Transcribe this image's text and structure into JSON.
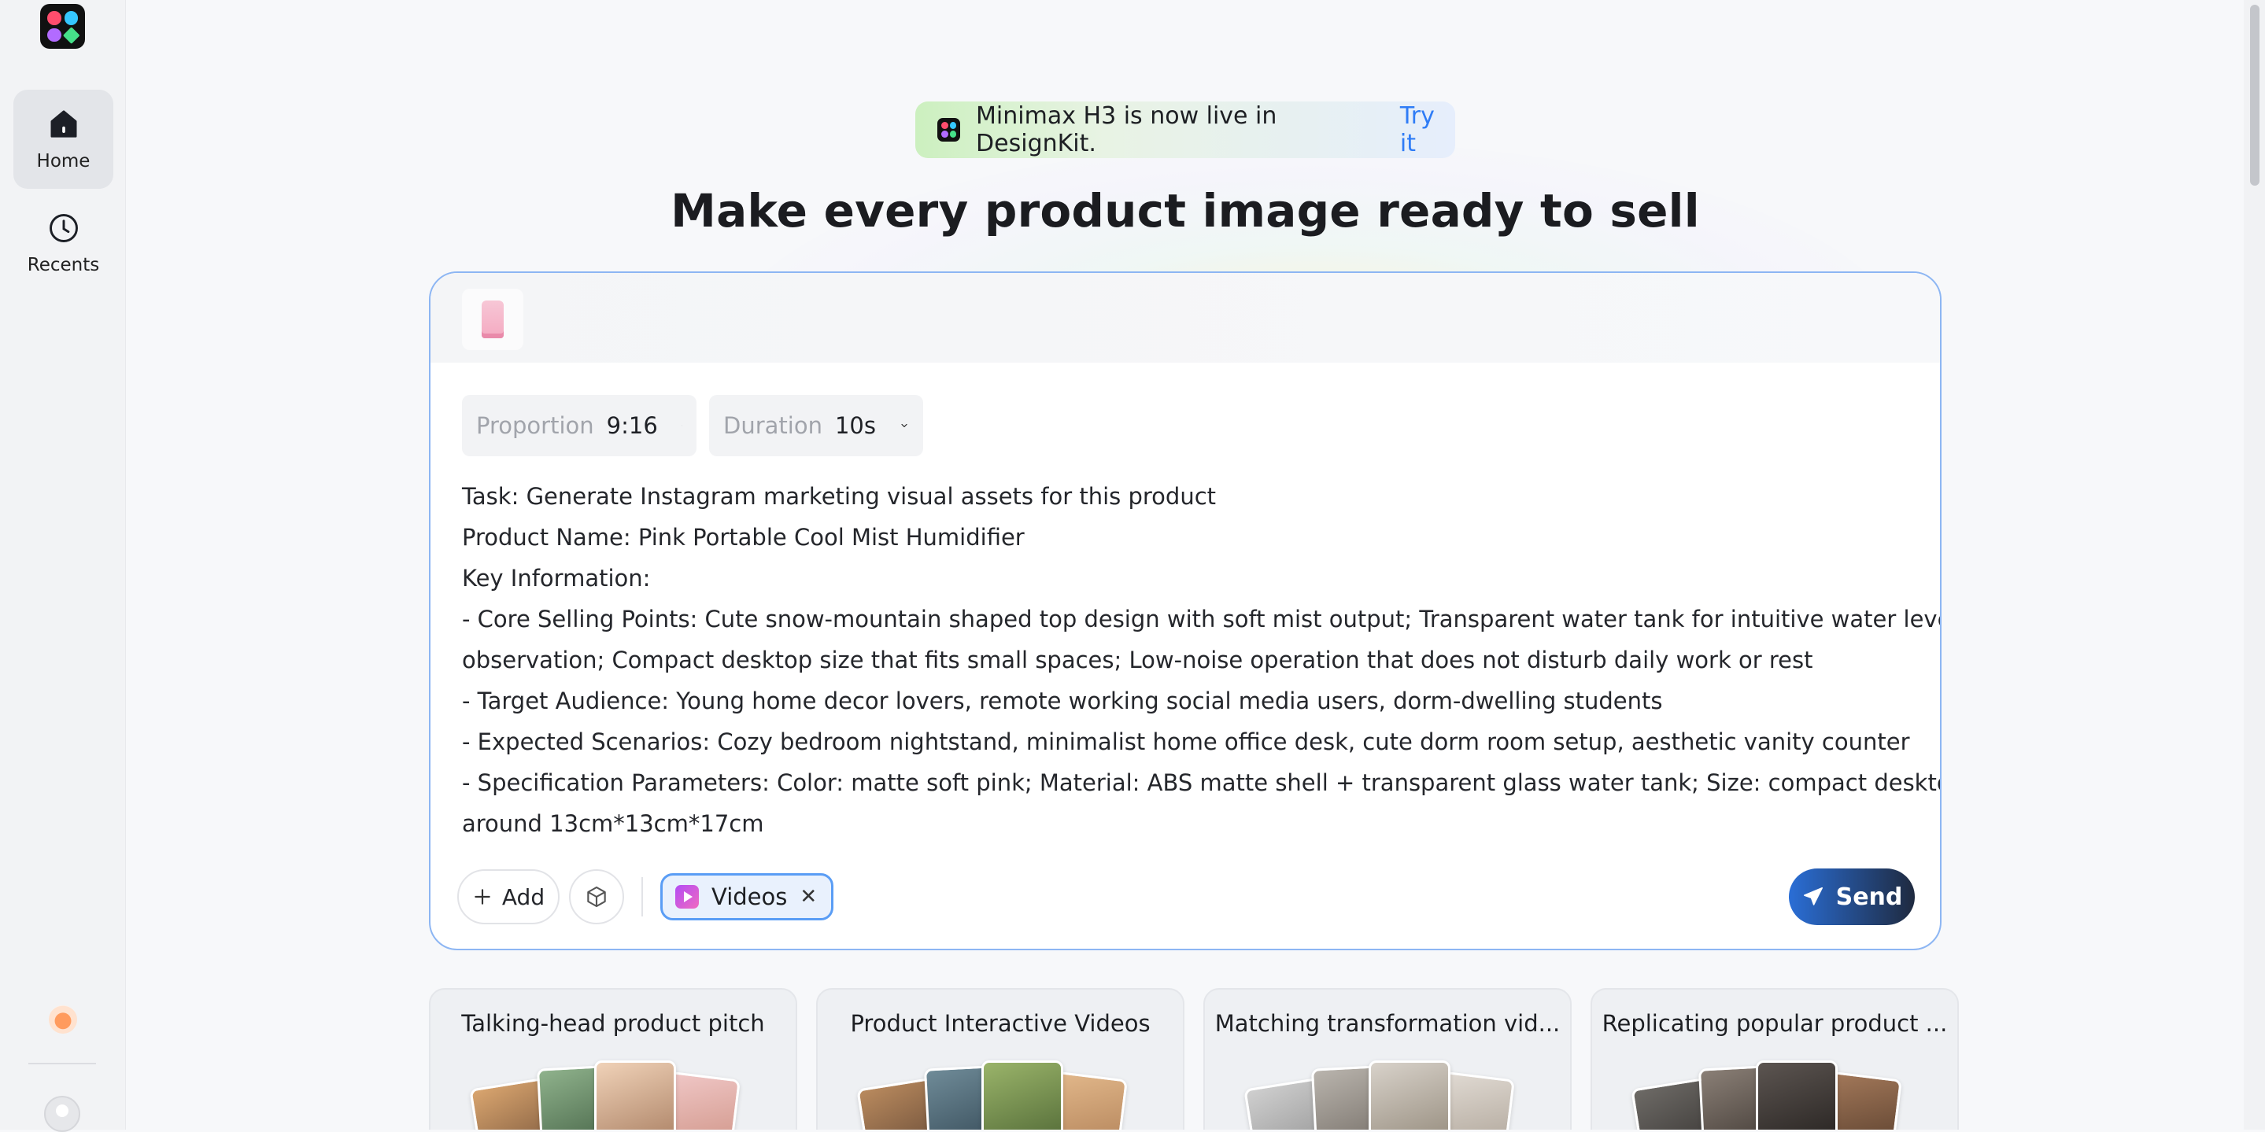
{
  "sidebar": {
    "logo_icon": "designkit-logo-icon",
    "items": [
      {
        "label": "Home",
        "icon": "home-icon",
        "active": true
      },
      {
        "label": "Recents",
        "icon": "clock-icon",
        "active": false
      }
    ]
  },
  "announcement": {
    "text": "Minimax H3 is now live in DesignKit.",
    "link": "Try it"
  },
  "headline": "Make every product image ready to sell",
  "composer": {
    "thumbnail_icon": "product-thumbnail",
    "selects": [
      {
        "label": "Proportion",
        "value": "9:16"
      },
      {
        "label": "Duration",
        "value": "10s"
      }
    ],
    "prompt_lines": [
      "Task: Generate Instagram marketing visual assets for this product",
      "Product Name: Pink Portable Cool Mist Humidifier",
      "Key Information:",
      "- Core Selling Points: Cute snow-mountain shaped top design with soft mist output; Transparent water tank for intuitive water level",
      "observation; Compact desktop size that fits small spaces; Low-noise operation that does not disturb daily work or rest",
      "- Target Audience: Young home decor lovers, remote working social media users, dorm-dwelling students",
      "- Expected Scenarios: Cozy bedroom nightstand, minimalist home office desk, cute dorm room setup, aesthetic vanity counter",
      "- Specification Parameters: Color: matte soft pink; Material: ABS matte shell + transparent glass water tank; Size: compact desktop size",
      "around 13cm*13cm*17cm"
    ],
    "add_label": "Add",
    "chip_label": "Videos",
    "chip_close": "✕",
    "send_label": "Send"
  },
  "cards": [
    {
      "title": "Talking-head product pitch"
    },
    {
      "title": "Product Interactive Videos"
    },
    {
      "title": "Matching transformation vid..."
    },
    {
      "title": "Replicating popular product ..."
    }
  ],
  "help_label": "?",
  "colors": {
    "accent": "#2f7cf6",
    "composer_border": "#8db6f3",
    "chip_border": "#5a9df5"
  }
}
